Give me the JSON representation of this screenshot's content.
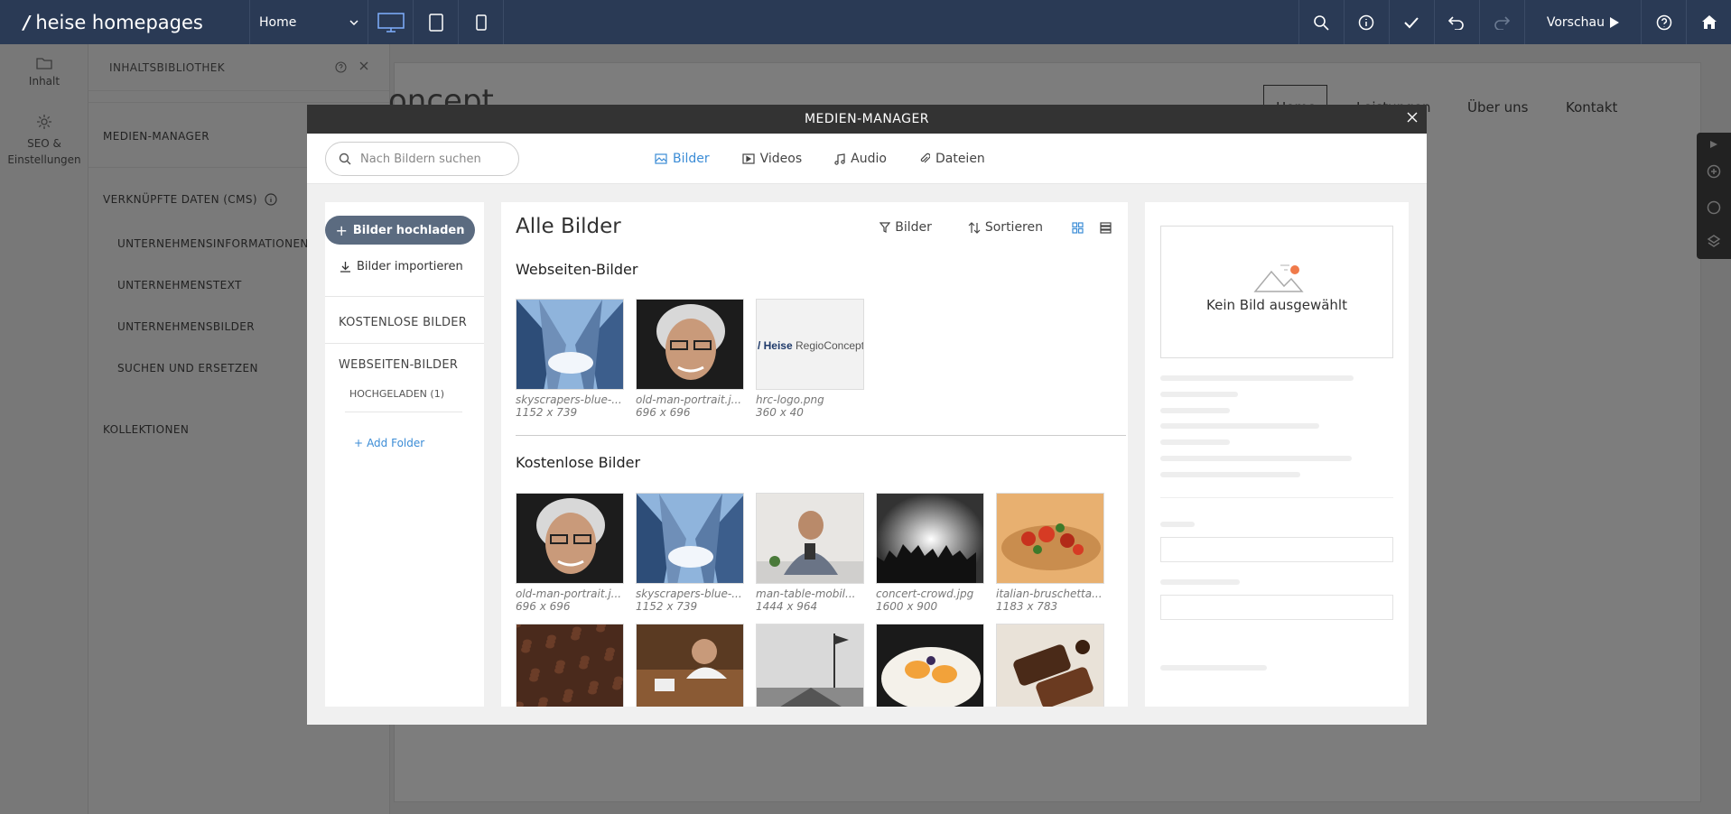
{
  "topbar": {
    "brand": "heise homepages",
    "page_selector": "Home",
    "preview_label": "Vorschau"
  },
  "iconbar": {
    "items": [
      {
        "label": "Inhalt"
      },
      {
        "label": "SEO & Einstellungen"
      }
    ]
  },
  "library": {
    "title": "INHALTSBIBLIOTHEK",
    "media_manager": "MEDIEN-MANAGER",
    "linked_data": "VERKNÜPFTE DATEN (CMS)",
    "sub_items": [
      "UNTERNEHMENSINFORMATIONEN",
      "UNTERNEHMENSTEXT",
      "UNTERNEHMENSBILDER",
      "SUCHEN UND ERSETZEN"
    ],
    "collections": "KOLLEKTIONEN"
  },
  "site": {
    "brand_fragment": "oncept",
    "nav": [
      "Home",
      "Leistungen",
      "Über uns",
      "Kontakt"
    ]
  },
  "modal": {
    "title": "MEDIEN-MANAGER",
    "search_placeholder": "Nach Bildern suchen",
    "tabs": [
      "Bilder",
      "Videos",
      "Audio",
      "Dateien"
    ],
    "upload_label": "Bilder hochladen",
    "import_label": "Bilder importieren",
    "free_images": "KOSTENLOSE BILDER",
    "site_images": "WEBSEITEN-BILDER",
    "uploaded": "HOCHGELADEN (1)",
    "add_folder": "Add Folder",
    "main_title": "Alle Bilder",
    "filter_label": "Bilder",
    "sort_label": "Sortieren",
    "section_site": "Webseiten-Bilder",
    "section_free": "Kostenlose Bilder",
    "no_image": "Kein Bild ausgewählt",
    "site_images_list": [
      {
        "name": "skyscrapers-blue-...",
        "size": "1152 x 739",
        "kind": "sky"
      },
      {
        "name": "old-man-portrait.j...",
        "size": "696 x 696",
        "kind": "man"
      },
      {
        "name": "hrc-logo.png",
        "size": "360 x 40",
        "kind": "logo",
        "logo_text": "Heise RegioConcept"
      }
    ],
    "free_images_list": [
      {
        "name": "old-man-portrait.j...",
        "size": "696 x 696",
        "kind": "man"
      },
      {
        "name": "skyscrapers-blue-...",
        "size": "1152 x 739",
        "kind": "sky"
      },
      {
        "name": "man-table-mobil...",
        "size": "1444 x 964",
        "kind": "table"
      },
      {
        "name": "concert-crowd.jpg",
        "size": "1600 x 900",
        "kind": "concert"
      },
      {
        "name": "italian-bruschetta...",
        "size": "1183 x 783",
        "kind": "food"
      }
    ],
    "more_images": [
      "coffee",
      "desk",
      "pier",
      "dessert",
      "chocolate"
    ]
  }
}
